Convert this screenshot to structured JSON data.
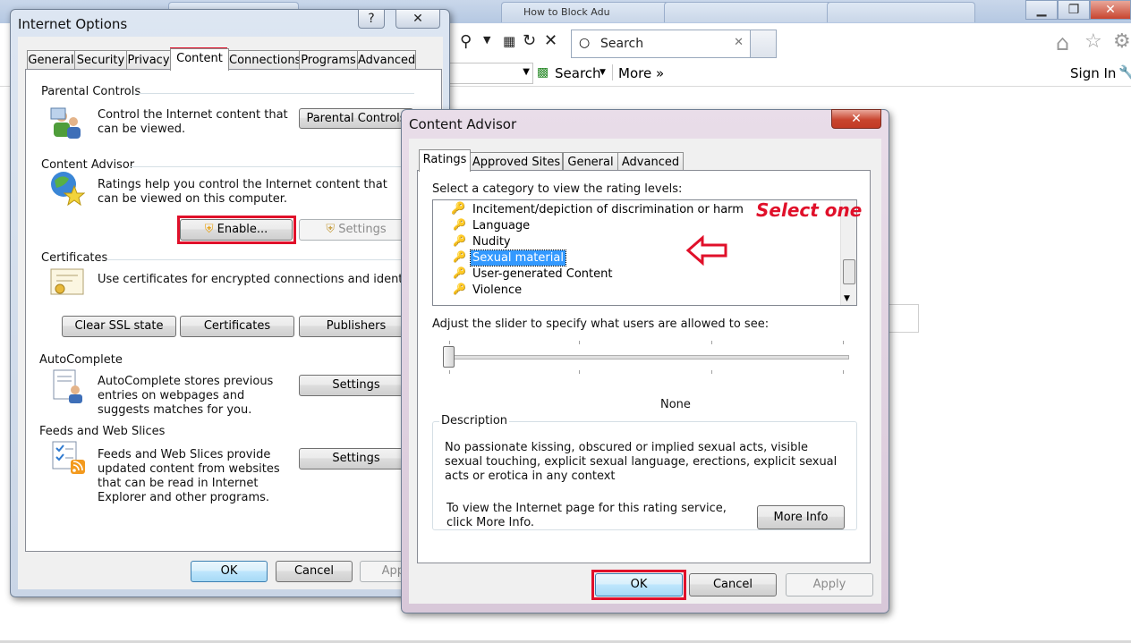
{
  "browser": {
    "tabs": [
      "",
      "How to Block Adu",
      "",
      ""
    ],
    "search_placeholder": "Search",
    "search_toolbar_label": "Search",
    "more_label": "More",
    "more_chevron": "»",
    "sign_in": "Sign In"
  },
  "internet_options": {
    "title": "Internet Options",
    "help_glyph": "?",
    "close_glyph": "✕",
    "tabs": [
      "General",
      "Security",
      "Privacy",
      "Content",
      "Connections",
      "Programs",
      "Advanced"
    ],
    "parental": {
      "label": "Parental Controls",
      "text": "Control the Internet content that can be viewed.",
      "button": "Parental Controls"
    },
    "advisor": {
      "label": "Content Advisor",
      "text": "Ratings help you control the Internet content that can be viewed on this computer.",
      "enable_button": "Enable...",
      "settings_button": "Settings"
    },
    "certificates": {
      "label": "Certificates",
      "text": "Use certificates for encrypted connections and identification",
      "clear_ssl": "Clear SSL state",
      "certificates_button": "Certificates",
      "publishers_button": "Publishers"
    },
    "autocomplete": {
      "label": "AutoComplete",
      "text": "AutoComplete stores previous entries on webpages and suggests matches for you.",
      "settings_button": "Settings"
    },
    "feeds": {
      "label": "Feeds and Web Slices",
      "text": "Feeds and Web Slices provide updated content from websites that can be read in Internet Explorer and other programs.",
      "settings_button": "Settings"
    },
    "ok": "OK",
    "cancel": "Cancel",
    "apply": "Apply"
  },
  "content_advisor": {
    "title": "Content Advisor",
    "close_glyph": "✕",
    "tabs": [
      "Ratings",
      "Approved Sites",
      "General",
      "Advanced"
    ],
    "category_prompt": "Select a category to view the rating levels:",
    "categories": [
      "Incitement/depiction of discrimination or harm",
      "Language",
      "Nudity",
      "Sexual material",
      "User-generated Content",
      "Violence"
    ],
    "selected_category": "Sexual material",
    "slider_prompt": "Adjust the slider to specify what users are allowed to see:",
    "slider_value": 0,
    "level_label": "None",
    "description_label": "Description",
    "description": "No passionate kissing, obscured or implied sexual acts, visible sexual touching, explicit sexual language, erections, explicit sexual acts or erotica in any context",
    "more_info_text": "To view the Internet page for this rating service, click More Info.",
    "more_info_button": "More Info",
    "ok": "OK",
    "cancel": "Cancel",
    "apply": "Apply"
  },
  "annotations": {
    "select_one": "Select one",
    "arrow": "⇦"
  },
  "colors": {
    "highlight_red": "#e0102a",
    "selection_blue": "#3399ff"
  }
}
